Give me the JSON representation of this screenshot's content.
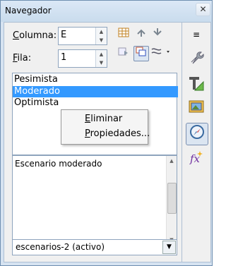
{
  "window": {
    "title": "Navegador",
    "close_symbol": "✕"
  },
  "column": {
    "label_underlined": "C",
    "label_rest": "olumna:",
    "value": "E"
  },
  "row": {
    "label_underlined": "F",
    "label_rest": "ila:",
    "value": "1"
  },
  "scenarios": {
    "items": [
      {
        "label": "Pesimista"
      },
      {
        "label": "Moderado"
      },
      {
        "label": "Optimista"
      }
    ],
    "selected": "Moderado"
  },
  "context_menu": {
    "items": [
      {
        "underlined": "E",
        "rest": "liminar"
      },
      {
        "underlined": "P",
        "rest": "ropiedades..."
      }
    ]
  },
  "description": {
    "text": "Escenario moderado"
  },
  "document_select": {
    "value": "escenarios-2 (activo)"
  },
  "colors": {
    "selection": "#3399ff",
    "frame": "#6f8fb0"
  },
  "icons": {
    "toolbar": [
      "table-icon",
      "up-arrow-icon",
      "down-arrow-icon",
      "insert-icon",
      "scenarios-icon",
      "drag-mode-icon"
    ],
    "sidebar": [
      "menu-icon",
      "wrench-icon",
      "styles-icon",
      "gallery-icon",
      "navigator-icon",
      "functions-icon"
    ]
  }
}
